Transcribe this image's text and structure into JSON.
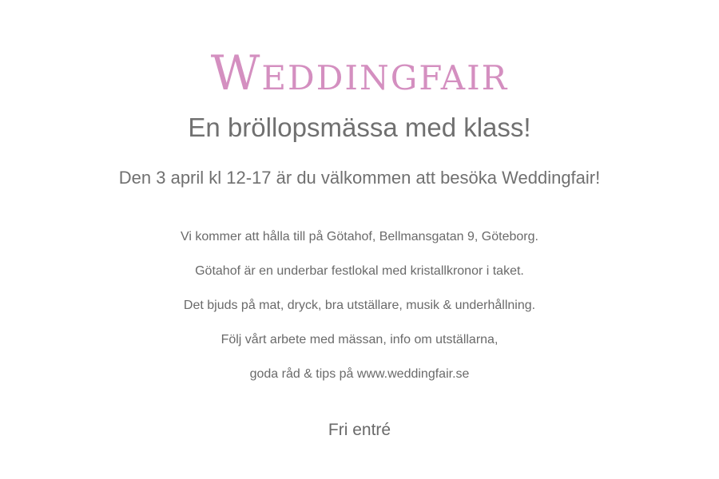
{
  "header": {
    "title": "Weddingfair",
    "subtitle": "En bröllopsmässa med klass!"
  },
  "intro": {
    "date_line": "Den 3 april kl 12-17 är du välkommen att besöka Weddingfair!"
  },
  "details": {
    "lines": [
      "Vi kommer att hålla till på Götahof, Bellmansgatan 9, Göteborg.",
      "Götahof är en underbar festlokal med kristallkronor i taket.",
      "Det bjuds på mat, dryck, bra utställare, musik & underhållning.",
      "Följ vårt arbete med mässan, info om utställarna,",
      "goda råd & tips på  www.weddingfair.se"
    ]
  },
  "footer": {
    "entry": "Fri entré"
  },
  "colors": {
    "title_pink": "#d48fc0",
    "text_gray": "#707070",
    "background": "#ffffff"
  }
}
